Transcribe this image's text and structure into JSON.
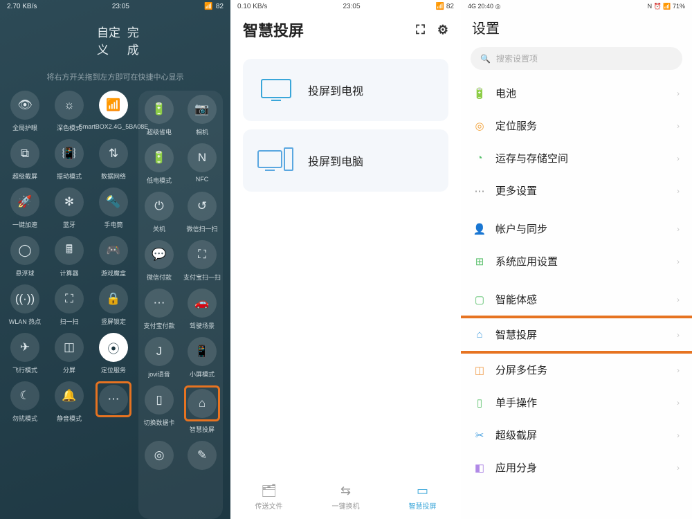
{
  "panel1": {
    "status": {
      "net": "2.70 KB/s",
      "time": "23:05",
      "batt": "82"
    },
    "customize": "自定义",
    "done": "完成",
    "hint": "将右方开关拖到左方即可在快捷中心显示",
    "left": [
      {
        "icon": "👁",
        "lbl": "全局护眼"
      },
      {
        "icon": "☼",
        "lbl": "深色模式"
      },
      {
        "icon": "📶",
        "lbl": "SmartBOX2.4G_5BA08E",
        "on": true
      },
      {
        "icon": "⧉",
        "lbl": "超级截屏"
      },
      {
        "icon": "📳",
        "lbl": "振动模式"
      },
      {
        "icon": "⇅",
        "lbl": "数据网络"
      },
      {
        "icon": "🚀",
        "lbl": "一键加速"
      },
      {
        "icon": "✻",
        "lbl": "蓝牙"
      },
      {
        "icon": "🔦",
        "lbl": "手电筒"
      },
      {
        "icon": "◯",
        "lbl": "悬浮球"
      },
      {
        "icon": "🖩",
        "lbl": "计算器"
      },
      {
        "icon": "🎮",
        "lbl": "游戏魔盒"
      },
      {
        "icon": "((·))",
        "lbl": "WLAN 热点"
      },
      {
        "icon": "⛶",
        "lbl": "扫一扫"
      },
      {
        "icon": "🔒",
        "lbl": "竖屏锁定"
      },
      {
        "icon": "✈",
        "lbl": "飞行模式"
      },
      {
        "icon": "◫",
        "lbl": "分屏"
      },
      {
        "icon": "⦿",
        "lbl": "定位服务",
        "on": true
      },
      {
        "icon": "☾",
        "lbl": "勿扰模式"
      },
      {
        "icon": "🔔",
        "lbl": "静音模式"
      },
      {
        "icon": "⋯",
        "lbl": "",
        "hl": true
      }
    ],
    "right": [
      {
        "icon": "🔋",
        "lbl": "超级省电"
      },
      {
        "icon": "📷",
        "lbl": "相机"
      },
      {
        "icon": "🔋",
        "lbl": "低电模式"
      },
      {
        "icon": "N",
        "lbl": "NFC"
      },
      {
        "icon": "⏻",
        "lbl": "关机"
      },
      {
        "icon": "↺",
        "lbl": "微信扫一扫"
      },
      {
        "icon": "💬",
        "lbl": "微信付款"
      },
      {
        "icon": "⛶",
        "lbl": "支付宝扫一扫"
      },
      {
        "icon": "⋯",
        "lbl": "支付宝付款"
      },
      {
        "icon": "🚗",
        "lbl": "驾驶场景"
      },
      {
        "icon": "J",
        "lbl": "jovi语音"
      },
      {
        "icon": "📱",
        "lbl": "小屏模式"
      },
      {
        "icon": "▯",
        "lbl": "切换数据卡"
      },
      {
        "icon": "⌂",
        "lbl": "智慧投屏",
        "hl": true
      },
      {
        "icon": "◎",
        "lbl": ""
      },
      {
        "icon": "✎",
        "lbl": ""
      }
    ]
  },
  "panel2": {
    "status": {
      "net": "0.10 KB/s",
      "time": "23:05",
      "batt": "82"
    },
    "title": "智慧投屏",
    "cards": [
      {
        "label": "投屏到电视",
        "type": "tv"
      },
      {
        "label": "投屏到电脑",
        "type": "pc"
      }
    ],
    "bottom": [
      {
        "label": "传送文件",
        "icon": "🗂"
      },
      {
        "label": "一键换机",
        "icon": "⇆"
      },
      {
        "label": "智慧投屏",
        "icon": "▭",
        "active": true
      }
    ]
  },
  "panel3": {
    "status": {
      "left": "4G 20:40 ◎",
      "right": "N ⏰ 📶 71%"
    },
    "title": "设置",
    "search": "搜索设置项",
    "items": [
      {
        "icon": "🔋",
        "color": "#4fbf5e",
        "label": "电池"
      },
      {
        "icon": "◎",
        "color": "#f2a23a",
        "label": "定位服务"
      },
      {
        "icon": "◔",
        "color": "#54c06a",
        "label": "运存与存储空间"
      },
      {
        "icon": "⋯",
        "color": "#888",
        "label": "更多设置"
      },
      {
        "gap": true
      },
      {
        "icon": "👤",
        "color": "#b089e6",
        "label": "帐户与同步"
      },
      {
        "icon": "⊞",
        "color": "#5fc270",
        "label": "系统应用设置"
      },
      {
        "gap": true
      },
      {
        "icon": "▢",
        "color": "#5fc270",
        "label": "智能体感"
      },
      {
        "icon": "⌂",
        "color": "#4fa3e0",
        "label": "智慧投屏",
        "hl": true
      },
      {
        "icon": "◫",
        "color": "#f0a050",
        "label": "分屏多任务"
      },
      {
        "icon": "▯",
        "color": "#5fc270",
        "label": "单手操作"
      },
      {
        "icon": "✂",
        "color": "#4fa3e0",
        "label": "超级截屏"
      },
      {
        "icon": "◧",
        "color": "#b089e6",
        "label": "应用分身"
      }
    ]
  }
}
